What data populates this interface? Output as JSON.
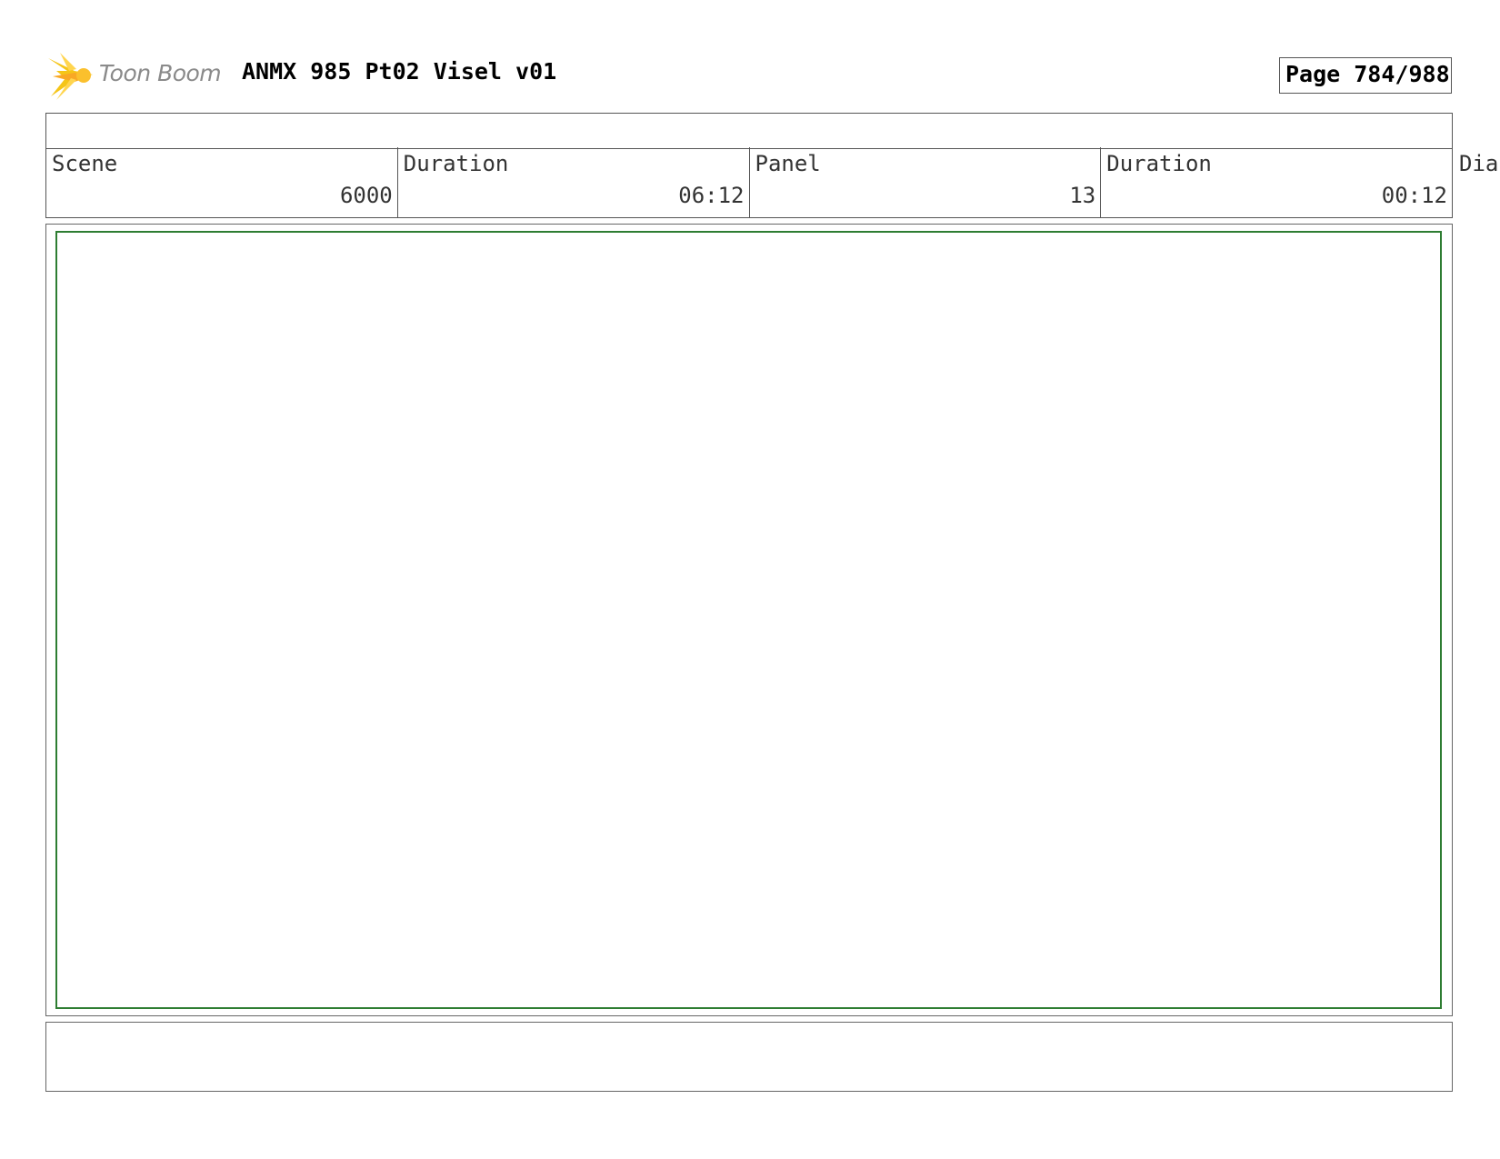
{
  "header": {
    "logo_text": "Toon Boom",
    "title": "ANMX 985 Pt02 Visel v01",
    "page_indicator": "Page 784/988"
  },
  "info": {
    "scene_label": "Scene",
    "scene_value": "6000",
    "scene_duration_label": "Duration",
    "scene_duration_value": "06:12",
    "panel_label": "Panel",
    "panel_value": "13",
    "panel_duration_label": "Duration",
    "panel_duration_value": "00:12",
    "dialogue_label_partial": "Dia"
  },
  "colors": {
    "logo_burst": "#f5c518",
    "logo_burst_core": "#f9a825",
    "panel_frame": "#2e7d32",
    "logo_text": "#8a8a8a"
  },
  "icons": {
    "logo": "toon-boom-starburst"
  }
}
